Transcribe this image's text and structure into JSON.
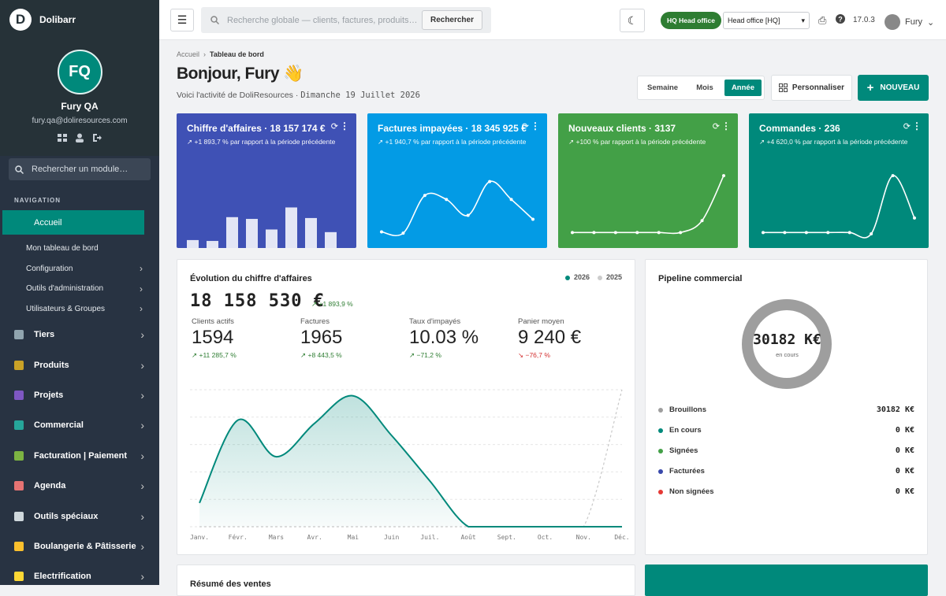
{
  "app": {
    "name": "Dolibarr",
    "logo_letter": "D"
  },
  "profile": {
    "initials": "FQ",
    "name": "Fury QA",
    "email": "fury.qa@doliresources.com"
  },
  "sidebar": {
    "search_placeholder": "Rechercher un module…",
    "nav_heading": "NAVIGATION",
    "active": "Accueil",
    "sub_items": [
      {
        "label": "Mon tableau de bord",
        "chevron": ""
      },
      {
        "label": "Configuration",
        "chevron": "›"
      },
      {
        "label": "Outils d'administration",
        "chevron": "›"
      },
      {
        "label": "Utilisateurs & Groupes",
        "chevron": "›"
      }
    ],
    "main_items": [
      {
        "label": "Tiers",
        "color": "#90a4ae"
      },
      {
        "label": "Produits",
        "color": "#c9a227"
      },
      {
        "label": "Projets",
        "color": "#7e57c2"
      },
      {
        "label": "Commercial",
        "color": "#26a69a"
      },
      {
        "label": "Facturation | Paiement",
        "color": "#7cb342"
      },
      {
        "label": "Agenda",
        "color": "#e57373"
      },
      {
        "label": "Outils spéciaux",
        "color": "#cfd8dc"
      },
      {
        "label": "Boulangerie & Pâtisserie",
        "color": "#fbc02d"
      },
      {
        "label": "Electrification",
        "color": "#fdd835"
      }
    ]
  },
  "topbar": {
    "search_placeholder": "Recherche globale — clients, factures, produits…",
    "search_button": "Rechercher",
    "hq_badge": "HQ Head office",
    "entity_select": "Head office [HQ]",
    "version": "17.0.3",
    "user": "Fury"
  },
  "page": {
    "breadcrumb_home": "Accueil",
    "breadcrumb_current": "Tableau de bord",
    "greeting": "Bonjour, Fury 👋",
    "subtitle": "Voici l'activité de DoliResources · ",
    "date": "Dimanche 19 Juillet 2026",
    "periods": [
      "Semaine",
      "Mois",
      "Année"
    ],
    "period_selected": "Année",
    "customize": "Personnaliser",
    "new": "NOUVEAU"
  },
  "kpis": [
    {
      "title": "Chiffre d'affaires · 18 157 174 €",
      "delta": "↗ +1 893,7 % par rapport à la période précédente",
      "color": "#3f51b5",
      "kind": "bar",
      "values": [
        0.09,
        0.08,
        0.35,
        0.33,
        0.21,
        0.46,
        0.34,
        0.18
      ]
    },
    {
      "title": "Factures impayées · 18 345 925 €",
      "delta": "↗ +1 940,7 % par rapport à la période précédente",
      "color": "#039be5",
      "kind": "line",
      "values": [
        0.03,
        0.01,
        0.58,
        0.52,
        0.28,
        0.79,
        0.52,
        0.22
      ]
    },
    {
      "title": "Nouveaux clients · 3137",
      "delta": "↗ +100 % par rapport à la période précédente",
      "color": "#43a047",
      "kind": "line",
      "values": [
        0.02,
        0.02,
        0.02,
        0.02,
        0.02,
        0.02,
        0.2,
        0.88
      ]
    },
    {
      "title": "Commandes · 236",
      "delta": "↗ +4 620,0 % par rapport à la période précédente",
      "color": "#00897b",
      "kind": "line",
      "values": [
        0.02,
        0.02,
        0.02,
        0.02,
        0.02,
        0.0,
        0.88,
        0.24
      ]
    }
  ],
  "revenue": {
    "title": "Évolution du chiffre d'affaires",
    "legend": [
      {
        "label": "2026",
        "color": "#00897b"
      },
      {
        "label": "2025",
        "color": "#cccccc"
      }
    ],
    "total": "18 158 530 €",
    "total_delta": "↗ +1 893,9 %",
    "stats": [
      {
        "label": "Clients actifs",
        "value": "1594",
        "delta": "↗ +11 285,7 %",
        "color": "#2e7d32"
      },
      {
        "label": "Factures",
        "value": "1965",
        "delta": "↗ +8 443,5 %",
        "color": "#2e7d32"
      },
      {
        "label": "Taux d'impayés",
        "value": "10.03 %",
        "delta": "↗ −71,2 %",
        "color": "#2e7d32"
      },
      {
        "label": "Panier moyen",
        "value": "9 240 €",
        "delta": "↘ −76,7 %",
        "color": "#d32f2f"
      }
    ]
  },
  "pipeline": {
    "title": "Pipeline commercial",
    "total": "30182 K€",
    "total_label": "en cours",
    "rows": [
      {
        "label": "Brouillons",
        "value": "30182 K€",
        "color": "#9e9e9e"
      },
      {
        "label": "En cours",
        "value": "0 K€",
        "color": "#00897b"
      },
      {
        "label": "Signées",
        "value": "0 K€",
        "color": "#43a047"
      },
      {
        "label": "Facturées",
        "value": "0 K€",
        "color": "#3949ab"
      },
      {
        "label": "Non signées",
        "value": "0 K€",
        "color": "#e53935"
      }
    ]
  },
  "sales_summary": {
    "title": "Résumé des ventes"
  },
  "chart_data": {
    "type": "area",
    "categories": [
      "Janv.",
      "Févr.",
      "Mars",
      "Avr.",
      "Mai",
      "Juin",
      "Juil.",
      "Août",
      "Sept.",
      "Oct.",
      "Nov.",
      "Déc."
    ],
    "series": [
      {
        "name": "2026",
        "values": [
          0.78,
          3.5,
          2.3,
          3.4,
          4.3,
          3.0,
          1.5,
          0,
          0,
          0,
          0,
          0
        ]
      },
      {
        "name": "2025",
        "values": [
          0,
          0,
          0,
          0,
          0,
          0,
          0,
          0,
          0,
          0,
          0,
          4.5
        ]
      }
    ]
  }
}
